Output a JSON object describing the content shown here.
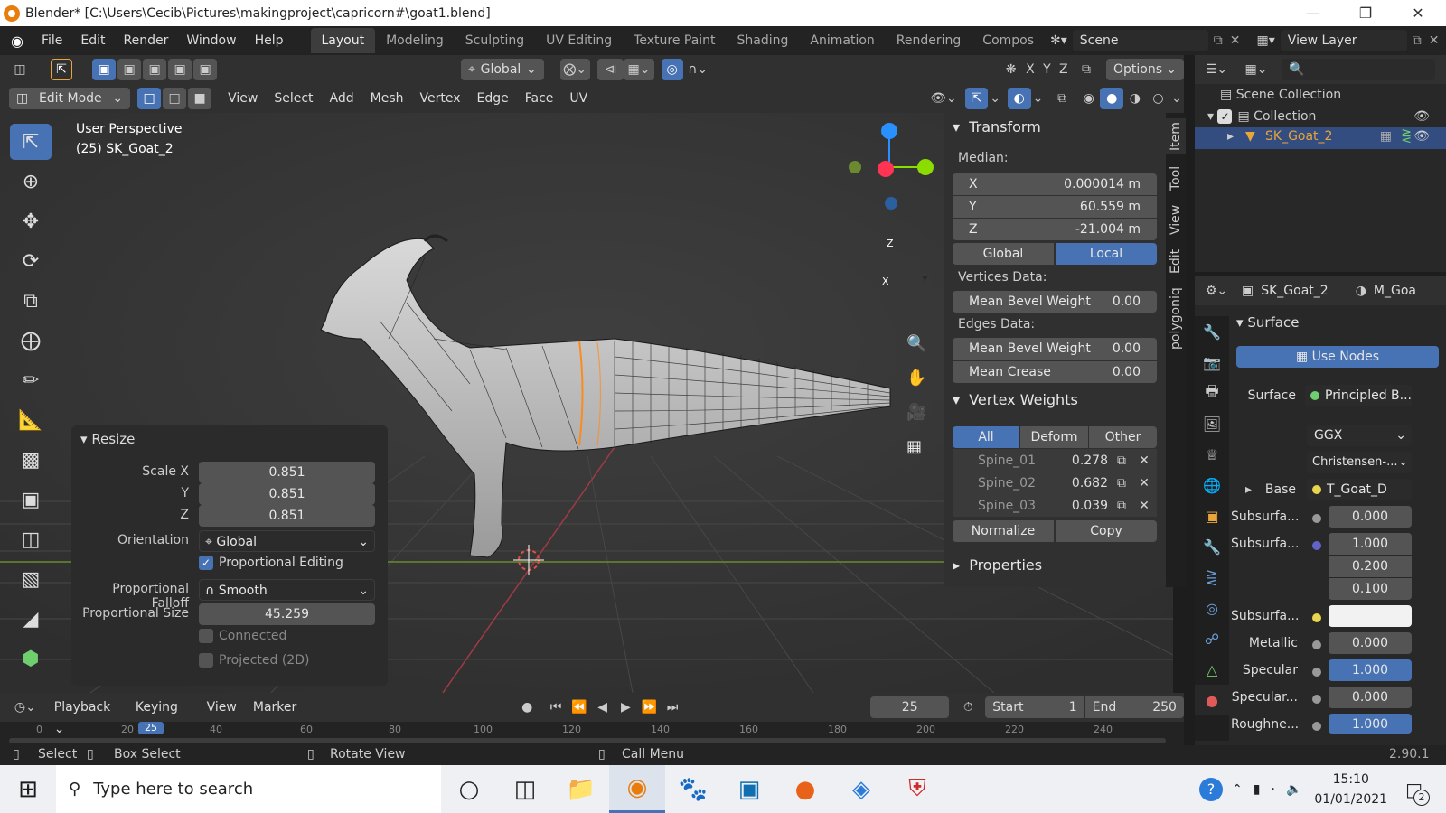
{
  "window": {
    "title": "Blender* [C:\\Users\\Cecib\\Pictures\\makingproject\\capricorn#\\goat1.blend]"
  },
  "menu": {
    "items": [
      "File",
      "Edit",
      "Render",
      "Window",
      "Help"
    ]
  },
  "workspaces": [
    "Layout",
    "Modeling",
    "Sculpting",
    "UV Editing",
    "Texture Paint",
    "Shading",
    "Animation",
    "Rendering",
    "Compos"
  ],
  "scene": {
    "name": "Scene",
    "view_layer": "View Layer"
  },
  "tool_header": {
    "orientation": "Global",
    "options": "Options",
    "axes": [
      "X",
      "Y",
      "Z"
    ]
  },
  "editor_header": {
    "mode": "Edit Mode",
    "menus": [
      "View",
      "Select",
      "Add",
      "Mesh",
      "Vertex",
      "Edge",
      "Face",
      "UV"
    ]
  },
  "viewport": {
    "perspective": "User Perspective",
    "object": "(25) SK_Goat_2",
    "gizmo": {
      "z": "Z",
      "x": "X",
      "y": "Y"
    }
  },
  "npanel": {
    "tabs": [
      "Item",
      "Tool",
      "View",
      "Edit",
      "polygoniq"
    ],
    "transform": {
      "title": "Transform",
      "median_label": "Median:",
      "x_label": "X",
      "x": "0.000014 m",
      "y_label": "Y",
      "y": "60.559 m",
      "z_label": "Z",
      "z": "-21.004 m",
      "global": "Global",
      "local": "Local",
      "vertices_data": "Vertices Data:",
      "mean_bevel_weight": "Mean Bevel Weight",
      "vbw": "0.00",
      "edges_data": "Edges Data:",
      "ebw": "0.00",
      "mean_crease": "Mean Crease",
      "crease": "0.00"
    },
    "vertex_weights": {
      "title": "Vertex Weights",
      "filters": [
        "All",
        "Deform",
        "Other"
      ],
      "groups": [
        {
          "name": "Spine_01",
          "value": "0.278"
        },
        {
          "name": "Spine_02",
          "value": "0.682"
        },
        {
          "name": "Spine_03",
          "value": "0.039"
        }
      ],
      "normalize": "Normalize",
      "copy": "Copy"
    },
    "properties": "Properties"
  },
  "resize_panel": {
    "title": "Resize",
    "scale_x_label": "Scale X",
    "scale_x": "0.851",
    "y_label": "Y",
    "scale_y": "0.851",
    "z_label": "Z",
    "scale_z": "0.851",
    "orientation_label": "Orientation",
    "orientation": "Global",
    "proportional_editing": "Proportional Editing",
    "falloff_label": "Proportional Falloff",
    "falloff": "Smooth",
    "size_label": "Proportional Size",
    "size": "45.259",
    "connected": "Connected",
    "projected": "Projected (2D)"
  },
  "outliner": {
    "scene_collection": "Scene Collection",
    "collection": "Collection",
    "object": "SK_Goat_2"
  },
  "properties": {
    "object": "SK_Goat_2",
    "material": "M_Goa",
    "surface_section": "Surface",
    "use_nodes": "Use Nodes",
    "surface_label": "Surface",
    "surface_value": "Principled B...",
    "distribution": "GGX",
    "subsurface_method": "Christensen-...",
    "base_label": "Base",
    "base_value": "T_Goat_D",
    "rows": [
      {
        "label": "Subsurfa...",
        "value": "0.000"
      },
      {
        "label": "Subsurfa...",
        "value": "1.000"
      },
      {
        "label": "",
        "value": "0.200"
      },
      {
        "label": "",
        "value": "0.100"
      },
      {
        "label": "Subsurfa...",
        "value": ""
      },
      {
        "label": "Metallic",
        "value": "0.000"
      },
      {
        "label": "Specular",
        "value": "1.000"
      },
      {
        "label": "Specular...",
        "value": "0.000"
      },
      {
        "label": "Roughne...",
        "value": "1.000"
      }
    ]
  },
  "timeline": {
    "menus": [
      "Playback",
      "Keying",
      "View",
      "Marker"
    ],
    "frame": "25",
    "start_label": "Start",
    "start": "1",
    "end_label": "End",
    "end": "250",
    "ruler": [
      "0",
      "20",
      "40",
      "60",
      "80",
      "100",
      "120",
      "140",
      "160",
      "180",
      "200",
      "220",
      "240"
    ]
  },
  "status": {
    "select": "Select",
    "box_select": "Box Select",
    "rotate_view": "Rotate View",
    "call_menu": "Call Menu",
    "version": "2.90.1"
  },
  "taskbar": {
    "search_placeholder": "Type here to search",
    "time": "15:10",
    "date": "01/01/2021",
    "notifications": "2"
  },
  "colors": {
    "accent": "#4772b3",
    "selected_vertex": "#ff8a1c",
    "x_axis": "#ff3352",
    "y_axis": "#8bdc00",
    "z_axis": "#2890ff"
  }
}
